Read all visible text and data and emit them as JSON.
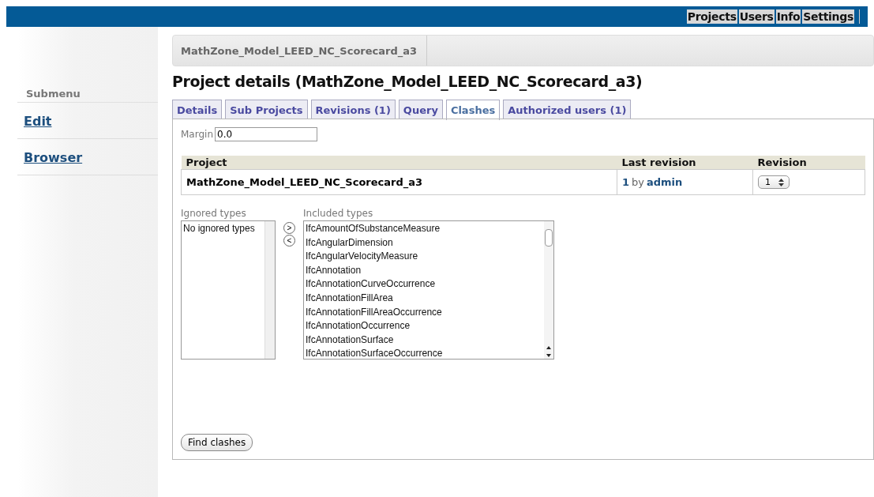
{
  "top_nav": [
    {
      "label": "Projects"
    },
    {
      "label": "Users"
    },
    {
      "label": "Info"
    },
    {
      "label": "Settings"
    }
  ],
  "sidebar": {
    "heading": "Submenu",
    "items": [
      {
        "label": "Edit"
      },
      {
        "label": "Browser"
      }
    ]
  },
  "breadcrumb": "MathZone_Model_LEED_NC_Scorecard_a3",
  "title": "Project details (MathZone_Model_LEED_NC_Scorecard_a3)",
  "tabs": [
    {
      "label": "Details",
      "selected": false
    },
    {
      "label": "Sub Projects",
      "selected": false
    },
    {
      "label": "Revisions (1)",
      "selected": false
    },
    {
      "label": "Query",
      "selected": false
    },
    {
      "label": "Clashes",
      "selected": true
    },
    {
      "label": "Authorized users (1)",
      "selected": false
    }
  ],
  "margin": {
    "label": "Margin",
    "value": "0.0"
  },
  "table": {
    "columns": [
      "Project",
      "Last revision",
      "Revision"
    ],
    "rows": [
      {
        "project": "MathZone_Model_LEED_NC_Scorecard_a3",
        "revision_number": "1",
        "by": "by",
        "user": "admin",
        "revision_select": "1"
      }
    ]
  },
  "ignored_types": {
    "label": "Ignored types",
    "items": [
      "No ignored types"
    ]
  },
  "move_buttons": [
    ">",
    "<"
  ],
  "included_types": {
    "label": "Included types",
    "items": [
      "IfcAmountOfSubstanceMeasure",
      "IfcAngularDimension",
      "IfcAngularVelocityMeasure",
      "IfcAnnotation",
      "IfcAnnotationCurveOccurrence",
      "IfcAnnotationFillArea",
      "IfcAnnotationFillAreaOccurrence",
      "IfcAnnotationOccurrence",
      "IfcAnnotationSurface",
      "IfcAnnotationSurfaceOccurrence"
    ]
  },
  "find_button": "Find clashes"
}
